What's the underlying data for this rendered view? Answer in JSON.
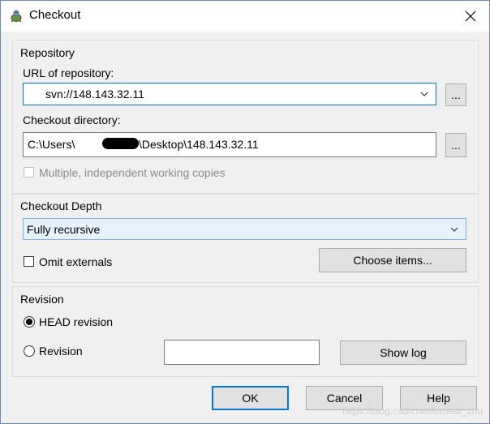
{
  "window": {
    "title": "Checkout",
    "close_icon": "close-icon",
    "app_icon": "tortoise-icon"
  },
  "repository": {
    "group_label": "Repository",
    "url_label": "URL of repository:",
    "url_value": "svn://148.143.32.11",
    "browse_label": "...",
    "dir_label": "Checkout directory:",
    "dir_prefix": "C:\\Users\\",
    "dir_suffix": "\\Desktop\\148.143.32.11",
    "dir_browse_label": "...",
    "multiple_label": "Multiple, independent working copies"
  },
  "depth": {
    "group_label": "Checkout Depth",
    "selected": "Fully recursive",
    "omit_label": "Omit externals",
    "choose_label": "Choose items..."
  },
  "revision": {
    "group_label": "Revision",
    "head_label": "HEAD revision",
    "rev_label": "Revision",
    "rev_value": "",
    "showlog_label": "Show log"
  },
  "buttons": {
    "ok": "OK",
    "cancel": "Cancel",
    "help": "Help"
  },
  "watermark": "https://blog.csdn.net/lomeat_zhu"
}
